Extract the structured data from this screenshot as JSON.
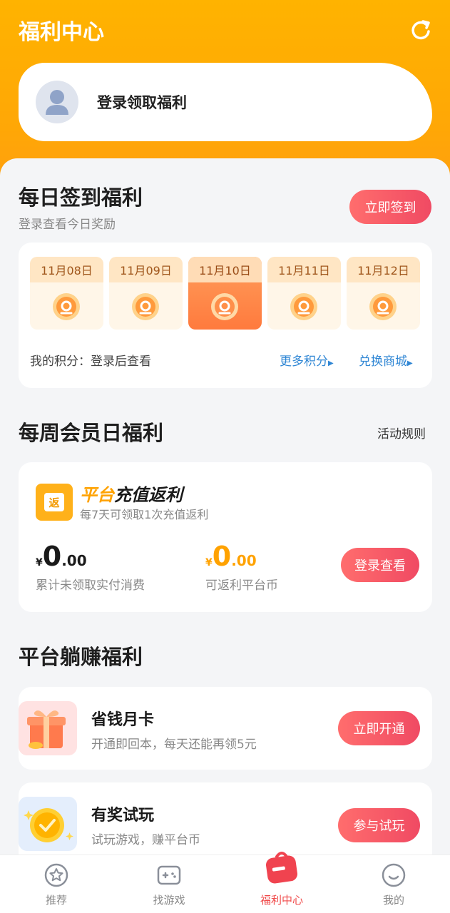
{
  "header": {
    "title": "福利中心",
    "refresh_icon": "refresh-icon"
  },
  "login_card": {
    "text": "登录领取福利",
    "avatar_icon": "user-avatar-icon"
  },
  "checkin": {
    "title": "每日签到福利",
    "subtitle": "登录查看今日奖励",
    "button": "立即签到",
    "days": [
      {
        "date": "11月08日",
        "active": false
      },
      {
        "date": "11月09日",
        "active": false
      },
      {
        "date": "11月10日",
        "active": true
      },
      {
        "date": "11月11日",
        "active": false
      },
      {
        "date": "11月12日",
        "active": false
      }
    ],
    "points_text": "我的积分：登录后查看",
    "more_points": "更多积分",
    "exchange": "兑换商城"
  },
  "weekly": {
    "title": "每周会员日福利",
    "rules": "活动规则",
    "logo_char": "返",
    "card_title_hl": "平台",
    "card_title_rest": "充值返利",
    "card_sub": "每7天可领取1次充值返利",
    "amount1": {
      "yen": "¥",
      "int": "0",
      "dec": ".00",
      "label": "累计未领取实付消费"
    },
    "amount2": {
      "yen": "¥",
      "int": "0",
      "dec": ".00",
      "label": "可返利平台币"
    },
    "button": "登录查看"
  },
  "earn": {
    "title": "平台躺赚福利",
    "items": [
      {
        "title": "省钱月卡",
        "sub": "开通即回本，每天还能再领5元",
        "button": "立即开通",
        "icon": "gift-box-icon"
      },
      {
        "title": "有奖试玩",
        "sub": "试玩游戏，赚平台币",
        "button": "参与试玩",
        "icon": "gold-coin-icon"
      }
    ]
  },
  "tabbar": [
    {
      "label": "推荐",
      "icon": "star-icon",
      "active": false
    },
    {
      "label": "找游戏",
      "icon": "gamepad-icon",
      "active": false
    },
    {
      "label": "福利中心",
      "icon": "gift-icon",
      "active": true
    },
    {
      "label": "我的",
      "icon": "smile-face-icon",
      "active": false
    }
  ],
  "colors": {
    "brand_orange": "#ffad0a",
    "accent_red": "#f04a63",
    "link_blue": "#2f86d4"
  }
}
